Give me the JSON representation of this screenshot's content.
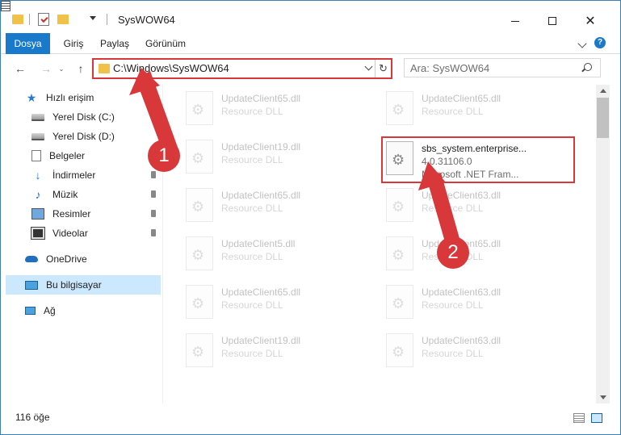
{
  "window": {
    "title": "SysWOW64",
    "controls": {
      "minimize": "",
      "maximize": "",
      "close": "✕"
    }
  },
  "ribbon": {
    "tabs": [
      {
        "label": "Dosya",
        "active": true
      },
      {
        "label": "Giriş"
      },
      {
        "label": "Paylaş"
      },
      {
        "label": "Görünüm"
      }
    ],
    "help": "?"
  },
  "nav": {
    "back": "←",
    "forward": "→",
    "history": "⌄",
    "up": "↑"
  },
  "address": {
    "path": "C:\\Windows\\SysWOW64",
    "refresh": "↻"
  },
  "search": {
    "placeholder": "Ara: SysWOW64"
  },
  "sidebar": {
    "items": [
      {
        "label": "Hızlı erişim",
        "icon": "star-icon"
      },
      {
        "label": "Yerel Disk (C:)",
        "icon": "disk-icon"
      },
      {
        "label": "Yerel Disk (D:)",
        "icon": "disk-icon"
      },
      {
        "label": "Belgeler",
        "icon": "documents-icon"
      },
      {
        "label": "İndirmeler",
        "icon": "download-icon",
        "pinned": true
      },
      {
        "label": "Müzik",
        "icon": "music-icon",
        "pinned": true
      },
      {
        "label": "Resimler",
        "icon": "pictures-icon",
        "pinned": true
      },
      {
        "label": "Videolar",
        "icon": "videos-icon",
        "pinned": true
      },
      {
        "label": "OneDrive",
        "icon": "onedrive-icon"
      },
      {
        "label": "Bu bilgisayar",
        "icon": "computer-icon",
        "selected": true
      },
      {
        "label": "Ağ",
        "icon": "network-icon"
      }
    ]
  },
  "files": {
    "left": [
      {
        "name": "UpdateClient65.dll",
        "type": "Resource DLL"
      },
      {
        "name": "UpdateClient19.dll",
        "type": "Resource DLL"
      },
      {
        "name": "UpdateClient65.dll",
        "type": "Resource DLL"
      },
      {
        "name": "UpdateClient5.dll",
        "type": "Resource DLL"
      },
      {
        "name": "UpdateClient65.dll",
        "type": "Resource DLL"
      },
      {
        "name": "UpdateClient19.dll",
        "type": "Resource DLL"
      }
    ],
    "right": [
      {
        "name": "UpdateClient65.dll",
        "type": "Resource DLL"
      },
      {
        "name": "UpdateClient63.dll",
        "type": "Resource DLL"
      },
      {
        "name": "UpdateClient65.dll",
        "type": "Resource DLL"
      },
      {
        "name": "UpdateClient63.dll",
        "type": "Resource DLL"
      },
      {
        "name": "UpdateClient63.dll",
        "type": "Resource DLL"
      }
    ],
    "highlighted": {
      "name": "sbs_system.enterprise...",
      "version": "4.0.31106.0",
      "description": "Microsoft .NET Fram..."
    }
  },
  "status": {
    "count": "116 öğe"
  },
  "annotations": {
    "step1": "1",
    "step2": "2",
    "color": "#d9383a"
  }
}
